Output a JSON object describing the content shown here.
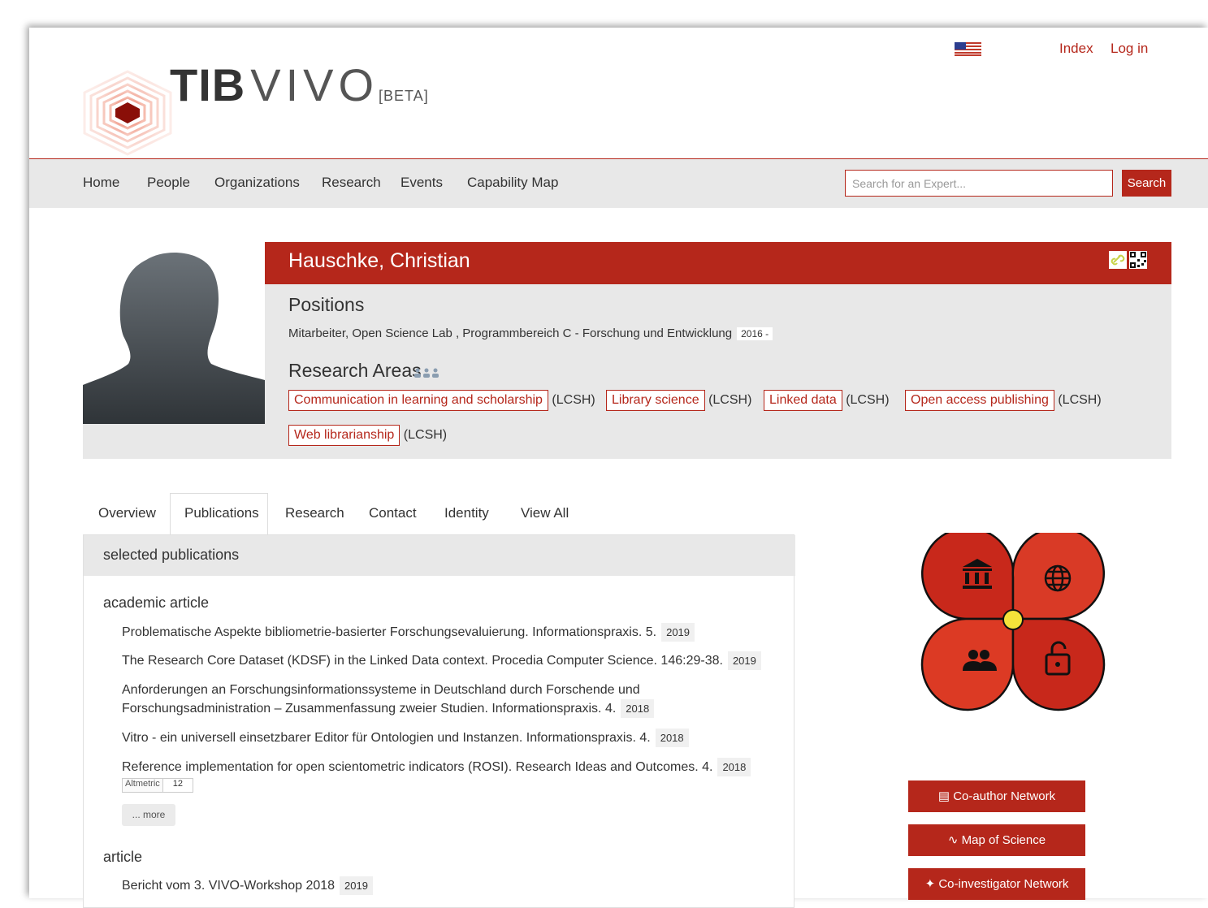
{
  "brand": {
    "tib": "TIB",
    "vivo": "VIVO",
    "beta": "[BETA]"
  },
  "top_links": {
    "index": "Index",
    "login": "Log in"
  },
  "nav": {
    "items": [
      "Home",
      "People",
      "Organizations",
      "Research",
      "Events",
      "Capability Map"
    ]
  },
  "search": {
    "placeholder": "Search for an Expert...",
    "button": "Search"
  },
  "profile": {
    "name": "Hauschke, Christian",
    "positions_heading": "Positions",
    "position": "Mitarbeiter, Open Science Lab , Programmbereich C - Forschung und Entwicklung",
    "position_years": "2016 -",
    "research_areas_heading": "Research Areas",
    "research_areas": [
      {
        "label": "Communication in learning and scholarship",
        "scheme": "(LCSH)"
      },
      {
        "label": "Library science",
        "scheme": "(LCSH)"
      },
      {
        "label": "Linked data",
        "scheme": "(LCSH)"
      },
      {
        "label": "Open access publishing",
        "scheme": "(LCSH)"
      },
      {
        "label": "Web librarianship",
        "scheme": "(LCSH)"
      }
    ]
  },
  "tabs": [
    "Overview",
    "Publications",
    "Research",
    "Contact",
    "Identity",
    "View All"
  ],
  "publications": {
    "heading": "selected publications",
    "categories": [
      {
        "name": "academic article"
      },
      {
        "name": "article"
      }
    ],
    "items": [
      {
        "text": "Problematische Aspekte bibliometrie-basierter Forschungsevaluierung.  Informationspraxis.  5.",
        "year": "2019"
      },
      {
        "text": "The Research Core Dataset (KDSF) in the Linked Data context.  Procedia Computer Science.  146:29-38.",
        "year": "2019"
      },
      {
        "line1": "Anforderungen an Forschungsinformationssysteme in Deutschland durch Forschende und",
        "text": "Forschungsadministration – Zusammenfassung zweier Studien.  Informationspraxis.  4.",
        "year": "2018"
      },
      {
        "text": "Vitro - ein universell einsetzbarer Editor für Ontologien und Instanzen.  Informationspraxis.  4.",
        "year": "2018"
      },
      {
        "text": "Reference implementation for open scientometric indicators (ROSI).  Research Ideas and Outcomes.  4.",
        "year": "2018"
      },
      {
        "text": "Bericht vom 3. VIVO-Workshop 2018",
        "year": "2019"
      }
    ],
    "altmetric": {
      "label": "Altmetric",
      "score": "12"
    },
    "more": "... more"
  },
  "visualizations": [
    "Co-author Network",
    "Map of Science",
    "Co-investigator Network"
  ],
  "colors": {
    "accent": "#b5271b",
    "nav_bg": "#e8e8e8",
    "clover_petal": "#d12f1f",
    "clover_center": "#f5e23a"
  }
}
